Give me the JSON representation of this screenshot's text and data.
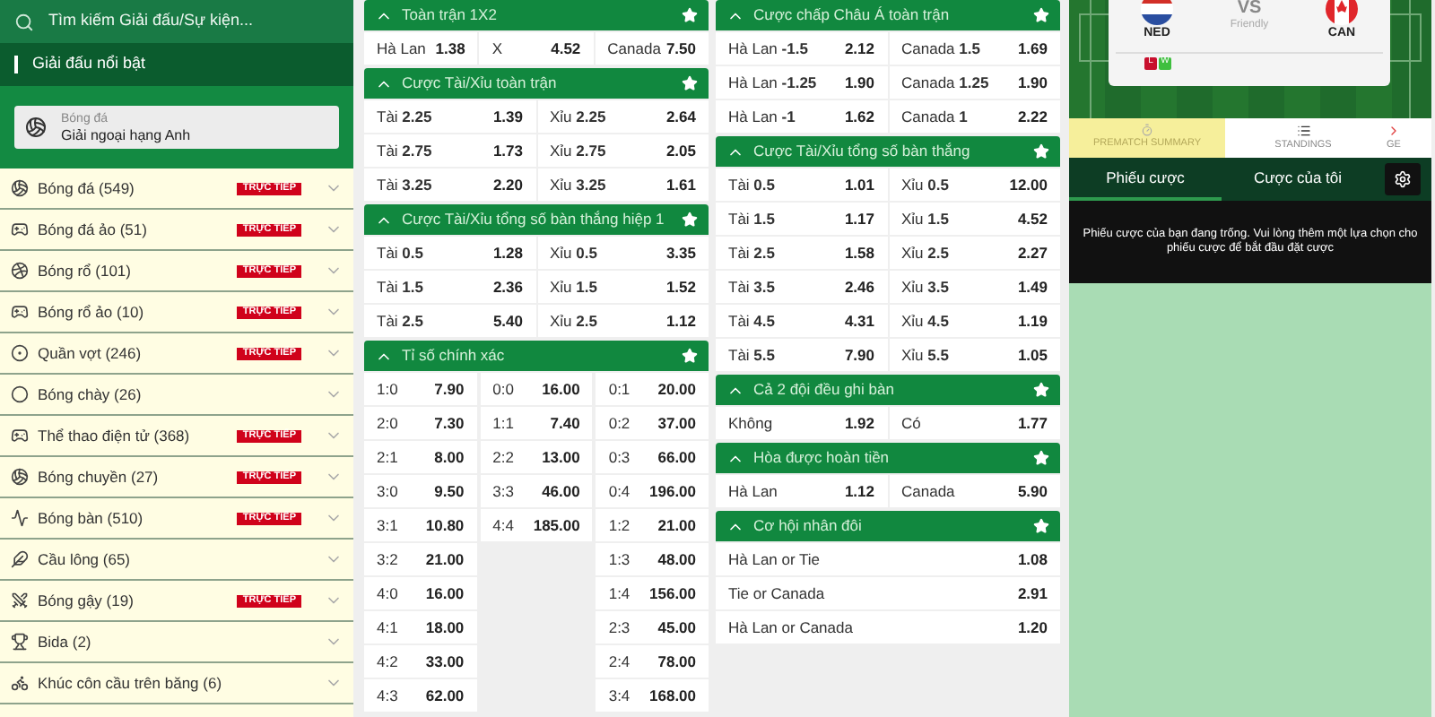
{
  "sidebar": {
    "search": {
      "placeholder": "Tìm kiếm Giải đấu/Sự kiện..."
    },
    "featured_title": "Giải đấu nổi bật",
    "featured": {
      "sport": "Bóng đá",
      "league": "Giải ngoại hạng Anh"
    },
    "sports": [
      {
        "label": "Bóng đá (549)",
        "badge": "TRỰC TIẾP"
      },
      {
        "label": "Bóng đá ảo (51)",
        "badge": "TRỰC TIẾP"
      },
      {
        "label": "Bóng rổ (101)",
        "badge": "TRỰC TIẾP"
      },
      {
        "label": "Bóng rổ ảo (10)",
        "badge": "TRỰC TIẾP"
      },
      {
        "label": "Quần vợt (246)",
        "badge": "TRỰC TIẾP"
      },
      {
        "label": "Bóng chày (26)"
      },
      {
        "label": "Thể thao điện tử (368)",
        "badge": "TRỰC TIẾP"
      },
      {
        "label": "Bóng chuyền (27)",
        "badge": "TRỰC TIẾP"
      },
      {
        "label": "Bóng bàn (510)",
        "badge": "TRỰC TIẾP"
      },
      {
        "label": "Cầu lông (65)"
      },
      {
        "label": "Bóng gậy (19)",
        "badge": "TRỰC TIẾP"
      },
      {
        "label": "Bida (2)"
      },
      {
        "label": "Khúc côn cầu trên băng (6)"
      }
    ]
  },
  "markets": [
    [
      {
        "kind": "odds",
        "title": "Toàn trận 1X2",
        "expanded": true,
        "rows": [
          [
            {
              "label": "Hà Lan",
              "odds": "1.38"
            },
            {
              "label": "X",
              "odds": "4.52"
            },
            {
              "label": "Canada",
              "odds": "7.50"
            }
          ]
        ]
      },
      {
        "kind": "odds",
        "title": "Cược Tài/Xỉu toàn trận",
        "expanded": true,
        "rows": [
          [
            {
              "label": "Tài **2.25**",
              "odds": "1.39"
            },
            {
              "label": "Xỉu **2.25**",
              "odds": "2.64"
            }
          ],
          [
            {
              "label": "Tài **2.75**",
              "odds": "1.73"
            },
            {
              "label": "Xỉu **2.75**",
              "odds": "2.05"
            }
          ],
          [
            {
              "label": "Tài **3.25**",
              "odds": "2.20"
            },
            {
              "label": "Xỉu **3.25**",
              "odds": "1.61"
            }
          ]
        ]
      },
      {
        "kind": "odds",
        "title": "Cược Tài/Xỉu tổng số bàn thắng hiệp 1",
        "expanded": true,
        "rows": [
          [
            {
              "label": "Tài **0.5**",
              "odds": "1.28"
            },
            {
              "label": "Xỉu **0.5**",
              "odds": "3.35"
            }
          ],
          [
            {
              "label": "Tài **1.5**",
              "odds": "2.36"
            },
            {
              "label": "Xỉu **1.5**",
              "odds": "1.52"
            }
          ],
          [
            {
              "label": "Tài **2.5**",
              "odds": "5.40"
            },
            {
              "label": "Xỉu **2.5**",
              "odds": "1.12"
            }
          ]
        ]
      },
      {
        "kind": "scores",
        "title": "Tỉ số chính xác",
        "expanded": true,
        "columns": [
          [
            {
              "label": "1:0",
              "odds": "7.90"
            },
            {
              "label": "2:0",
              "odds": "7.30"
            },
            {
              "label": "2:1",
              "odds": "8.00"
            },
            {
              "label": "3:0",
              "odds": "9.50"
            },
            {
              "label": "3:1",
              "odds": "10.80"
            },
            {
              "label": "3:2",
              "odds": "21.00"
            },
            {
              "label": "4:0",
              "odds": "16.00"
            },
            {
              "label": "4:1",
              "odds": "18.00"
            },
            {
              "label": "4:2",
              "odds": "33.00"
            },
            {
              "label": "4:3",
              "odds": "62.00"
            }
          ],
          [
            {
              "label": "0:0",
              "odds": "16.00"
            },
            {
              "label": "1:1",
              "odds": "7.40"
            },
            {
              "label": "2:2",
              "odds": "13.00"
            },
            {
              "label": "3:3",
              "odds": "46.00"
            },
            {
              "label": "4:4",
              "odds": "185.00"
            }
          ],
          [
            {
              "label": "0:1",
              "odds": "20.00"
            },
            {
              "label": "0:2",
              "odds": "37.00"
            },
            {
              "label": "0:3",
              "odds": "66.00"
            },
            {
              "label": "0:4",
              "odds": "196.00"
            },
            {
              "label": "1:2",
              "odds": "21.00"
            },
            {
              "label": "1:3",
              "odds": "48.00"
            },
            {
              "label": "1:4",
              "odds": "156.00"
            },
            {
              "label": "2:3",
              "odds": "45.00"
            },
            {
              "label": "2:4",
              "odds": "78.00"
            },
            {
              "label": "3:4",
              "odds": "168.00"
            }
          ]
        ]
      }
    ],
    [
      {
        "kind": "odds",
        "title": "Cược chấp Châu Á toàn trận",
        "expanded": true,
        "rows": [
          [
            {
              "label": "Hà Lan **-1.5**",
              "odds": "2.12"
            },
            {
              "label": "Canada **1.5**",
              "odds": "1.69"
            }
          ],
          [
            {
              "label": "Hà Lan **-1.25**",
              "odds": "1.90"
            },
            {
              "label": "Canada **1.25**",
              "odds": "1.90"
            }
          ],
          [
            {
              "label": "Hà Lan **-1**",
              "odds": "1.62"
            },
            {
              "label": "Canada **1**",
              "odds": "2.22"
            }
          ]
        ]
      },
      {
        "kind": "odds",
        "title": "Cược Tài/Xỉu tổng số bàn thắng",
        "expanded": true,
        "rows": [
          [
            {
              "label": "Tài **0.5**",
              "odds": "1.01"
            },
            {
              "label": "Xỉu **0.5**",
              "odds": "12.00"
            }
          ],
          [
            {
              "label": "Tài **1.5**",
              "odds": "1.17"
            },
            {
              "label": "Xỉu **1.5**",
              "odds": "4.52"
            }
          ],
          [
            {
              "label": "Tài **2.5**",
              "odds": "1.58"
            },
            {
              "label": "Xỉu **2.5**",
              "odds": "2.27"
            }
          ],
          [
            {
              "label": "Tài **3.5**",
              "odds": "2.46"
            },
            {
              "label": "Xỉu **3.5**",
              "odds": "1.49"
            }
          ],
          [
            {
              "label": "Tài **4.5**",
              "odds": "4.31"
            },
            {
              "label": "Xỉu **4.5**",
              "odds": "1.19"
            }
          ],
          [
            {
              "label": "Tài **5.5**",
              "odds": "7.90"
            },
            {
              "label": "Xỉu **5.5**",
              "odds": "1.05"
            }
          ]
        ]
      },
      {
        "kind": "odds",
        "title": "Cả 2 đội đều ghi bàn",
        "expanded": true,
        "rows": [
          [
            {
              "label": "Không",
              "odds": "1.92"
            },
            {
              "label": "Có",
              "odds": "1.77"
            }
          ]
        ]
      },
      {
        "kind": "odds",
        "title": "Hòa được hoàn tiền",
        "expanded": true,
        "rows": [
          [
            {
              "label": "Hà Lan",
              "odds": "1.12"
            },
            {
              "label": "Canada",
              "odds": "5.90"
            }
          ]
        ]
      },
      {
        "kind": "odds",
        "title": "Cơ hội nhân đôi",
        "expanded": true,
        "rows": [
          [
            {
              "label": "Hà Lan or Tie",
              "odds": "1.08"
            }
          ],
          [
            {
              "label": "Tie or Canada",
              "odds": "2.91"
            }
          ],
          [
            {
              "label": "Hà Lan or Canada",
              "odds": "1.20"
            }
          ]
        ]
      }
    ]
  ],
  "match": {
    "home": "NED",
    "versus": "VS",
    "type": "Friendly",
    "away": "CAN",
    "form": [
      {
        "label": "L",
        "color": "#c8102e"
      },
      {
        "label": "W",
        "color": "#3fbf3f"
      }
    ]
  },
  "info_tabs": [
    {
      "label": "PREMATCH SUMMARY",
      "selected": true
    },
    {
      "label": "STANDINGS",
      "selected": false
    },
    {
      "label": "GE",
      "selected": false
    }
  ],
  "betslip": {
    "tabs": [
      {
        "label": "Phiếu cược",
        "selected": true
      },
      {
        "label": "Cược của tôi",
        "selected": false
      }
    ],
    "message": "Phiếu cược của bạn đang trống. Vui lòng thêm một lựa chọn cho phiếu cược để bắt đầu đặt cược"
  }
}
